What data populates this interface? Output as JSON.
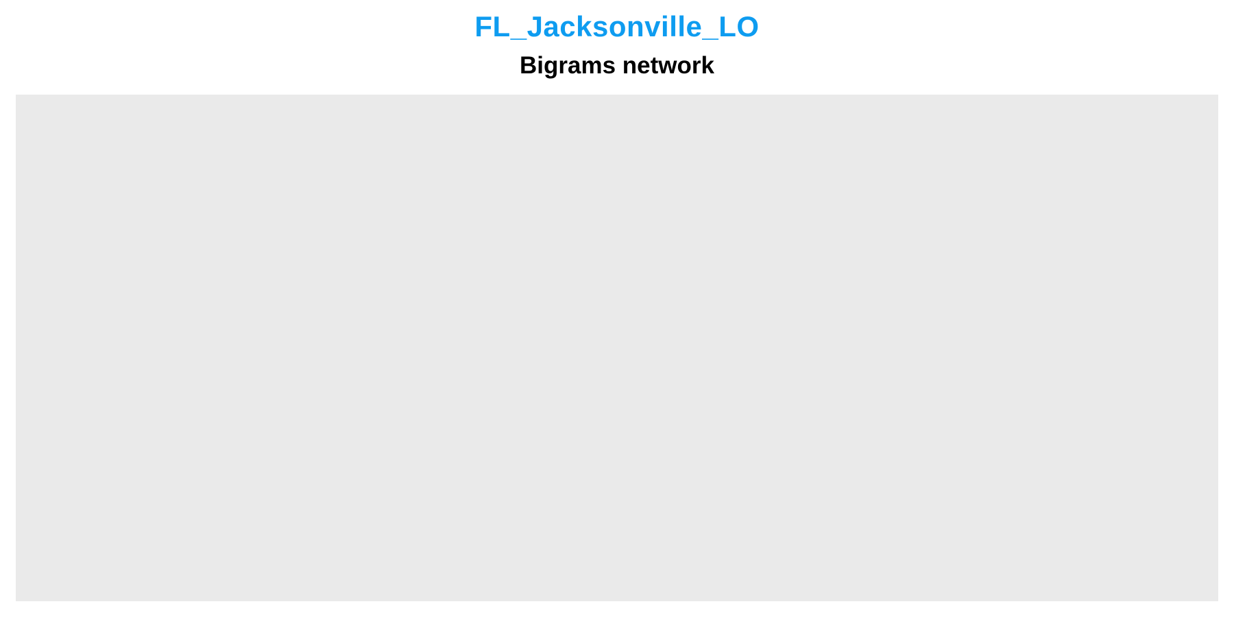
{
  "chart_data": {
    "type": "network",
    "title": "FL_Jacksonville_LO",
    "subtitle": "Bigrams network",
    "nodes": [],
    "edges": [],
    "grid": false,
    "legend": "none"
  },
  "colors": {
    "title": "#0e9cf0",
    "subtitle": "#000000",
    "panel_background": "#eaeaea",
    "page_background": "#ffffff"
  }
}
